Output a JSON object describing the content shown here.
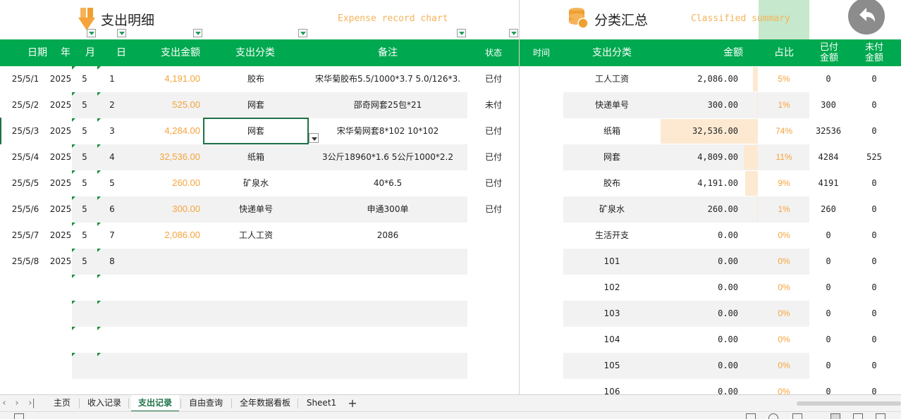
{
  "title": {
    "left_cn": "支出明细",
    "left_en": "Expense record chart",
    "right_cn": "分类汇总",
    "right_en": "Classified summary"
  },
  "icons": {
    "left_title": "arrow-down-icon",
    "right_title": "coins-icon",
    "back": "undo-arrow-icon"
  },
  "colors": {
    "header_green": "#00a94f",
    "amount_orange": "#f5a33a",
    "bar_fill": "#fde9d2",
    "active_tab": "#1e7145"
  },
  "headers": {
    "date": "日期",
    "year": "年",
    "month": "月",
    "day": "日",
    "amount": "支出金额",
    "category": "支出分类",
    "note": "备注",
    "status": "状态",
    "time": "时间",
    "s_category": "支出分类",
    "s_amount": "金额",
    "ratio": "占比",
    "paid_l1": "已付",
    "paid_l2": "金额",
    "unpaid_l1": "未付",
    "unpaid_l2": "金额"
  },
  "records": [
    {
      "date": "25/5/1",
      "year": "2025",
      "month": "5",
      "day": "1",
      "amount": "4,191.00",
      "category": "胶布",
      "note": "宋华菊胶布5.5/1000*3.7  5.0/126*3.",
      "status": "已付"
    },
    {
      "date": "25/5/2",
      "year": "2025",
      "month": "5",
      "day": "2",
      "amount": "525.00",
      "category": "网套",
      "note": "邵奇网套25包*21",
      "status": "未付"
    },
    {
      "date": "25/5/3",
      "year": "2025",
      "month": "5",
      "day": "3",
      "amount": "4,284.00",
      "category": "网套",
      "note": "宋华菊网套8*102  10*102",
      "status": "已付"
    },
    {
      "date": "25/5/4",
      "year": "2025",
      "month": "5",
      "day": "4",
      "amount": "32,536.00",
      "category": "纸箱",
      "note": "3公斤18960*1.6  5公斤1000*2.2",
      "status": "已付"
    },
    {
      "date": "25/5/5",
      "year": "2025",
      "month": "5",
      "day": "5",
      "amount": "260.00",
      "category": "矿泉水",
      "note": "40*6.5",
      "status": "已付"
    },
    {
      "date": "25/5/6",
      "year": "2025",
      "month": "5",
      "day": "6",
      "amount": "300.00",
      "category": "快递单号",
      "note": "申通300单",
      "status": "已付"
    },
    {
      "date": "25/5/7",
      "year": "2025",
      "month": "5",
      "day": "7",
      "amount": "2,086.00",
      "category": "工人工资",
      "note": "2086",
      "status": ""
    },
    {
      "date": "25/5/8",
      "year": "2025",
      "month": "5",
      "day": "8",
      "amount": "",
      "category": "",
      "note": "",
      "status": ""
    }
  ],
  "summary": [
    {
      "category": "工人工资",
      "amount": "2,086.00",
      "ratio": "5%",
      "ratio_value": 0.0527,
      "paid": "0",
      "unpaid": "0"
    },
    {
      "category": "快递单号",
      "amount": "300.00",
      "ratio": "1%",
      "ratio_value": 0.0092,
      "paid": "300",
      "unpaid": "0"
    },
    {
      "category": "纸箱",
      "amount": "32,536.00",
      "ratio": "74%",
      "ratio_value": 1.0,
      "paid": "32536",
      "unpaid": "0"
    },
    {
      "category": "网套",
      "amount": "4,809.00",
      "ratio": "11%",
      "ratio_value": 0.1478,
      "paid": "4284",
      "unpaid": "525"
    },
    {
      "category": "胶布",
      "amount": "4,191.00",
      "ratio": "9%",
      "ratio_value": 0.1288,
      "paid": "4191",
      "unpaid": "0"
    },
    {
      "category": "矿泉水",
      "amount": "260.00",
      "ratio": "1%",
      "ratio_value": 0.008,
      "paid": "260",
      "unpaid": "0"
    },
    {
      "category": "生活开支",
      "amount": "0.00",
      "ratio": "0%",
      "ratio_value": 0,
      "paid": "0",
      "unpaid": "0"
    },
    {
      "category": "101",
      "amount": "0.00",
      "ratio": "0%",
      "ratio_value": 0,
      "paid": "0",
      "unpaid": "0"
    },
    {
      "category": "102",
      "amount": "0.00",
      "ratio": "0%",
      "ratio_value": 0,
      "paid": "0",
      "unpaid": "0"
    },
    {
      "category": "103",
      "amount": "0.00",
      "ratio": "0%",
      "ratio_value": 0,
      "paid": "0",
      "unpaid": "0"
    },
    {
      "category": "104",
      "amount": "0.00",
      "ratio": "0%",
      "ratio_value": 0,
      "paid": "0",
      "unpaid": "0"
    },
    {
      "category": "105",
      "amount": "0.00",
      "ratio": "0%",
      "ratio_value": 0,
      "paid": "0",
      "unpaid": "0"
    },
    {
      "category": "106",
      "amount": "0.00",
      "ratio": "0%",
      "ratio_value": 0,
      "paid": "0",
      "unpaid": "0"
    }
  ],
  "sheet_tabs": [
    {
      "label": "主页",
      "active": false
    },
    {
      "label": "收入记录",
      "active": false
    },
    {
      "label": "支出记录",
      "active": true
    },
    {
      "label": "自由查询",
      "active": false
    },
    {
      "label": "全年数据看板",
      "active": false
    },
    {
      "label": "Sheet1",
      "active": false
    }
  ],
  "tab_nav": {
    "first": "‹",
    "prev": "›",
    "last": "›|",
    "add": "+"
  }
}
